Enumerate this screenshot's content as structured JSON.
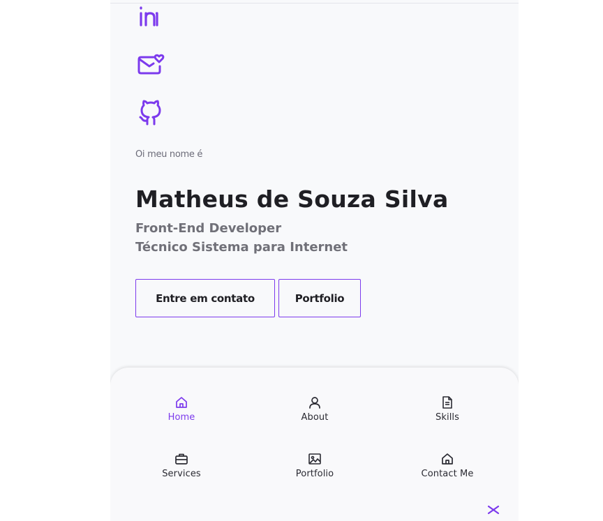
{
  "social": [
    {
      "icon": "linkedin-icon"
    },
    {
      "icon": "mail-heart-icon"
    },
    {
      "icon": "github-icon"
    }
  ],
  "hero": {
    "greeting": "Oi meu nome é",
    "name": "Matheus de Souza Silva",
    "role_1": "Front-End Developer",
    "role_2": "Técnico Sistema para Internet",
    "contact_button": "Entre em contato",
    "portfolio_button": "Portfolio"
  },
  "nav": {
    "items": [
      {
        "label": "Home",
        "icon": "home-icon",
        "active": true
      },
      {
        "label": "About",
        "icon": "user-icon",
        "active": false
      },
      {
        "label": "Skills",
        "icon": "document-icon",
        "active": false
      },
      {
        "label": "Services",
        "icon": "briefcase-icon",
        "active": false
      },
      {
        "label": "Portfolio",
        "icon": "image-icon",
        "active": false
      },
      {
        "label": "Contact Me",
        "icon": "home-icon",
        "active": false
      }
    ],
    "close_icon": "close-icon"
  },
  "colors": {
    "accent": "#7c3aed",
    "text_dark": "#1f1f24",
    "text_muted": "#707078",
    "background": "#f8f9fb"
  }
}
